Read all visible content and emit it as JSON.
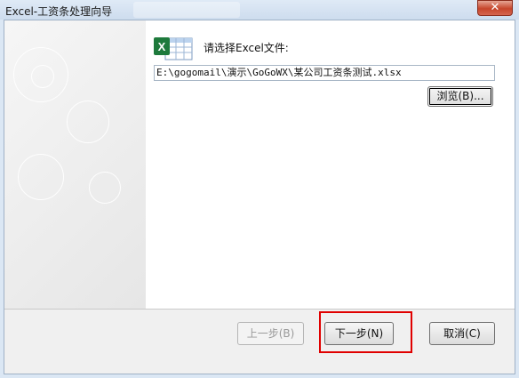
{
  "window": {
    "title": "Excel-工资条处理向导",
    "close_glyph": "✕"
  },
  "step": {
    "prompt": "请选择Excel文件:",
    "file_path": "E:\\gogomail\\演示\\GoGoWX\\某公司工资条测试.xlsx",
    "browse_label": "浏览(B)..."
  },
  "footer": {
    "prev_label": "上一步(B)",
    "next_label": "下一步(N)",
    "cancel_label": "取消(C)"
  },
  "icons": {
    "file_icon": "excel-icon"
  },
  "colors": {
    "highlight": "#e00000",
    "excel_green": "#1e7a3c"
  }
}
